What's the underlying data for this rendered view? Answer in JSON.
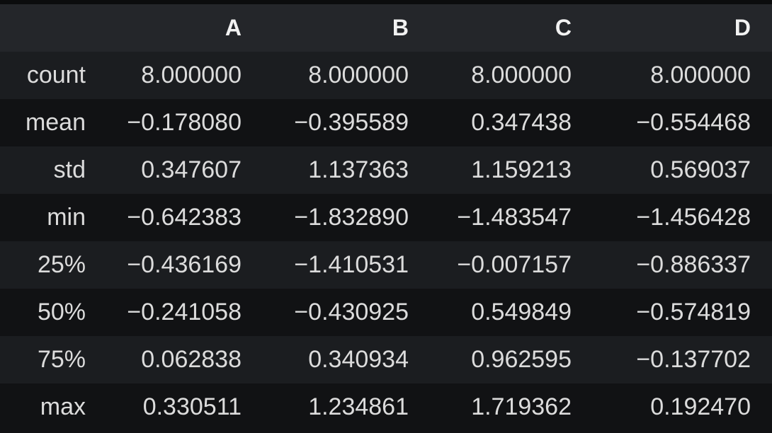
{
  "table": {
    "columns": [
      "A",
      "B",
      "C",
      "D"
    ],
    "rows": [
      {
        "label": "count",
        "values": [
          "8.000000",
          "8.000000",
          "8.000000",
          "8.000000"
        ]
      },
      {
        "label": "mean",
        "values": [
          "−0.178080",
          "−0.395589",
          "0.347438",
          "−0.554468"
        ]
      },
      {
        "label": "std",
        "values": [
          "0.347607",
          "1.137363",
          "1.159213",
          "0.569037"
        ]
      },
      {
        "label": "min",
        "values": [
          "−0.642383",
          "−1.832890",
          "−1.483547",
          "−1.456428"
        ]
      },
      {
        "label": "25%",
        "values": [
          "−0.436169",
          "−1.410531",
          "−0.007157",
          "−0.886337"
        ]
      },
      {
        "label": "50%",
        "values": [
          "−0.241058",
          "−0.430925",
          "0.549849",
          "−0.574819"
        ]
      },
      {
        "label": "75%",
        "values": [
          "0.062838",
          "0.340934",
          "0.962595",
          "−0.137702"
        ]
      },
      {
        "label": "max",
        "values": [
          "0.330511",
          "1.234861",
          "1.719362",
          "0.192470"
        ]
      }
    ]
  }
}
